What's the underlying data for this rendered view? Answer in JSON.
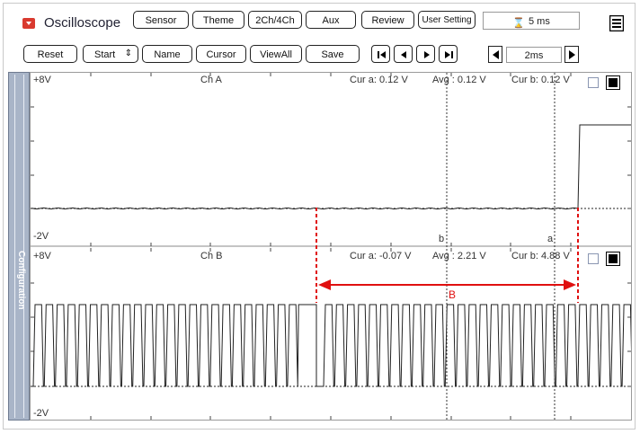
{
  "app": {
    "title": "Oscilloscope"
  },
  "toolbar_top": {
    "sensor": "Sensor",
    "theme": "Theme",
    "channels": "2Ch/4Ch",
    "aux": "Aux",
    "review": "Review",
    "user_setting": "User Setting",
    "time_display": "5 ms"
  },
  "toolbar_bottom": {
    "reset": "Reset",
    "start": "Start",
    "name": "Name",
    "cursor": "Cursor",
    "viewall": "ViewAll",
    "save": "Save",
    "time_div": "2ms"
  },
  "side_panel": {
    "label": "Configuration"
  },
  "channel_a": {
    "name": "Ch A",
    "top_label": "+8V",
    "bottom_label": "-2V",
    "cur_a": "Cur a: 0.12 V",
    "avg": "Avg  : 0.12 V",
    "cur_b": "Cur b: 0.12 V",
    "cursor_a_label": "a",
    "cursor_b_label": "b"
  },
  "channel_b": {
    "name": "Ch B",
    "top_label": "+8V",
    "bottom_label": "-2V",
    "cur_a": "Cur a: -0.07 V",
    "avg": "Avg  : 2.21 V",
    "cur_b": "Cur b: 4.88 V"
  },
  "annotation": {
    "label": "B",
    "color": "#e01010"
  },
  "icons": {
    "app": "dropdown-menu-icon",
    "menu": "hamburger-menu-icon",
    "time": "clock-icon"
  }
}
